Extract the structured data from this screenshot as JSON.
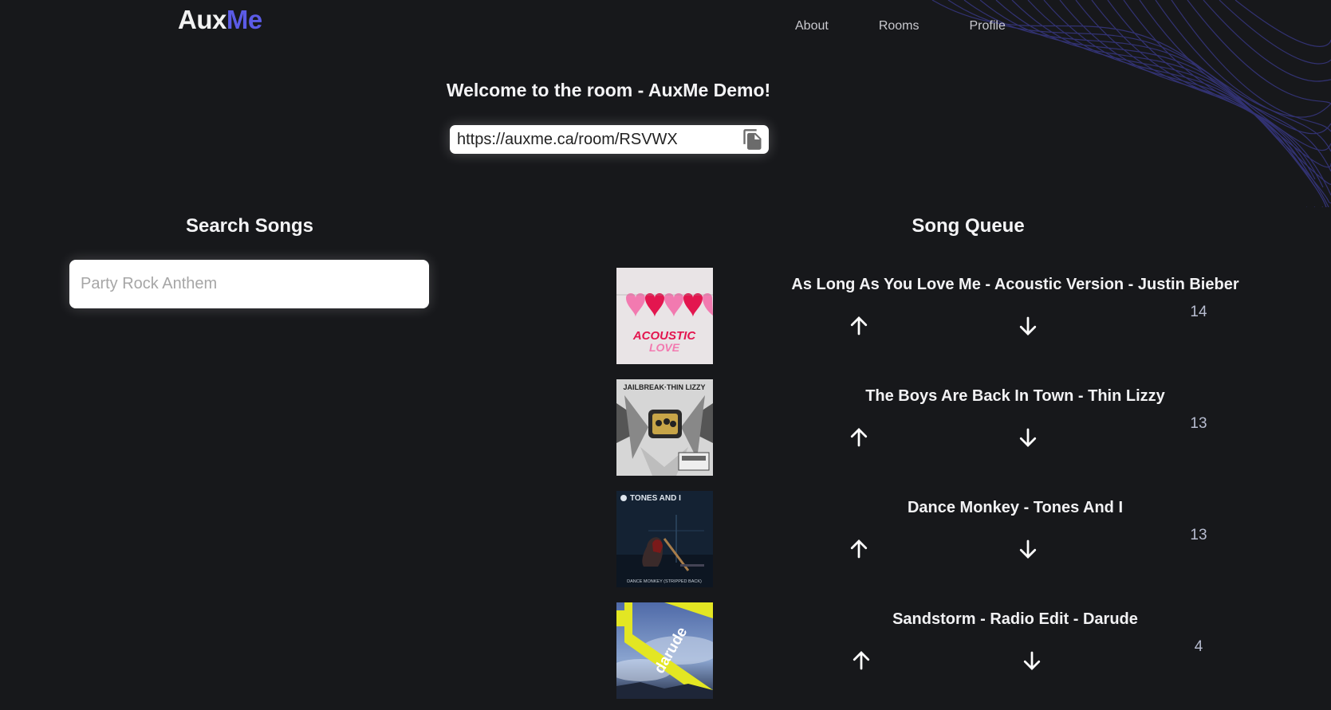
{
  "app": {
    "logo_part1": "Aux",
    "logo_part2": "Me",
    "brand_color": "#5b5be6"
  },
  "nav": {
    "items": [
      {
        "label": "About"
      },
      {
        "label": "Rooms"
      },
      {
        "label": "Profile"
      }
    ]
  },
  "room": {
    "title": "Welcome to the room - AuxMe Demo!",
    "link": "https://auxme.ca/room/RSVWX",
    "copy_icon": "copy-icon"
  },
  "search": {
    "title": "Search Songs",
    "placeholder": "Party Rock Anthem"
  },
  "queue": {
    "title": "Song Queue",
    "songs": [
      {
        "title": "As Long As You Love Me - Acoustic Version - Justin Bieber",
        "votes": "14",
        "art_text_1": "ACOUSTIC",
        "art_text_2": "LOVE"
      },
      {
        "title": "The Boys Are Back In Town - Thin Lizzy",
        "votes": "13",
        "art_text_1": "JAILBREAK·THIN LIZZY"
      },
      {
        "title": "Dance Monkey - Tones And I",
        "votes": "13",
        "art_text_1": "TONES AND I",
        "art_text_2": "DANCE MONKEY (STRIPPED BACK)"
      },
      {
        "title": "Sandstorm - Radio Edit - Darude",
        "votes": "4",
        "art_text_1": "darude"
      }
    ]
  }
}
